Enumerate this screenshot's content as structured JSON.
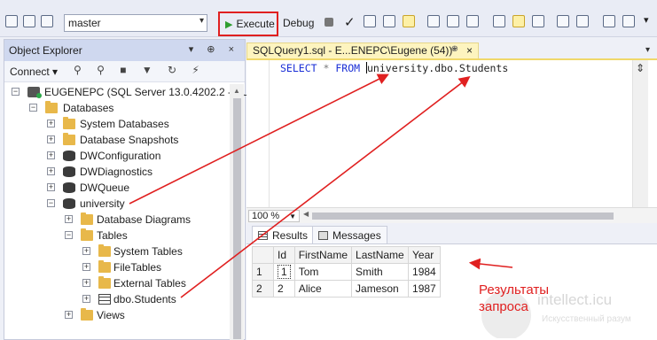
{
  "toolbar": {
    "database_value": "master",
    "execute_label": "Execute",
    "execute_hotkey": "x",
    "debug_label": "Debug",
    "debug_hotkey": "D"
  },
  "object_explorer": {
    "title": "Object Explorer",
    "connect_label": "Connect",
    "server_label": "EUGENEPC (SQL Server 13.0.4202.2 - EU",
    "tree": [
      {
        "label": "Databases",
        "icon": "folder-icon"
      },
      {
        "label": "System Databases",
        "icon": "folder-icon"
      },
      {
        "label": "Database Snapshots",
        "icon": "folder-icon"
      },
      {
        "label": "DWConfiguration",
        "icon": "database-icon"
      },
      {
        "label": "DWDiagnostics",
        "icon": "database-icon"
      },
      {
        "label": "DWQueue",
        "icon": "database-icon"
      },
      {
        "label": "university",
        "icon": "database-icon"
      },
      {
        "label": "Database Diagrams",
        "icon": "folder-icon"
      },
      {
        "label": "Tables",
        "icon": "folder-icon"
      },
      {
        "label": "System Tables",
        "icon": "folder-icon"
      },
      {
        "label": "FileTables",
        "icon": "folder-icon"
      },
      {
        "label": "External Tables",
        "icon": "folder-icon"
      },
      {
        "label": "dbo.Students",
        "icon": "table-icon"
      },
      {
        "label": "Views",
        "icon": "folder-icon"
      }
    ]
  },
  "editor": {
    "tab_title": "SQLQuery1.sql - E...ENEPC\\Eugene (54))*",
    "tab_pin": "⊕",
    "tab_close": "×",
    "code": {
      "kw1": "SELECT",
      "star": "*",
      "kw2": "FROM",
      "target": "university.dbo.Students"
    },
    "zoom": "100 %"
  },
  "results": {
    "tab_results": "Results",
    "tab_messages": "Messages",
    "columns": [
      "Id",
      "FirstName",
      "LastName",
      "Year"
    ],
    "rows": [
      {
        "num": "1",
        "cells": [
          "1",
          "Tom",
          "Smith",
          "1984"
        ]
      },
      {
        "num": "2",
        "cells": [
          "2",
          "Alice",
          "Jameson",
          "1987"
        ]
      }
    ]
  },
  "annotation": {
    "text": "Результаты\nзапроса",
    "color": "#e02020"
  },
  "watermark": {
    "text": "intellect.icu",
    "subtitle": "Искусственный разум"
  }
}
